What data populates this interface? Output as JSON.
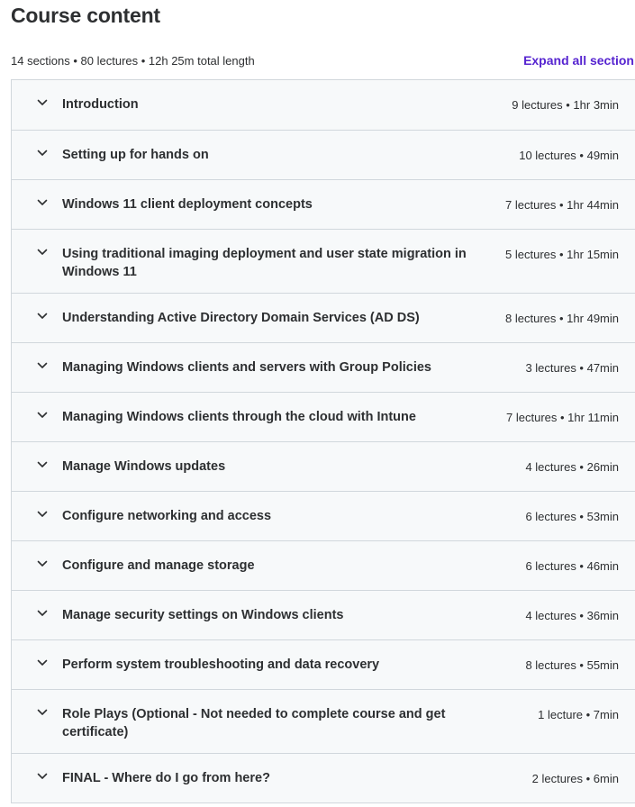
{
  "header": {
    "title": "Course content",
    "summary": "14 sections • 80 lectures • 12h 25m total length",
    "expand_all_label": "Expand all section"
  },
  "sections": [
    {
      "title": "Introduction",
      "meta": "9 lectures • 1hr 3min"
    },
    {
      "title": "Setting up for hands on",
      "meta": "10 lectures • 49min"
    },
    {
      "title": "Windows 11 client deployment concepts",
      "meta": "7 lectures • 1hr 44min"
    },
    {
      "title": "Using traditional imaging deployment and user state migration in Windows 11",
      "meta": "5 lectures • 1hr 15min"
    },
    {
      "title": "Understanding Active Directory Domain Services (AD DS)",
      "meta": "8 lectures • 1hr 49min"
    },
    {
      "title": "Managing Windows clients and servers with Group Policies",
      "meta": "3 lectures • 47min"
    },
    {
      "title": "Managing Windows clients through the cloud with Intune",
      "meta": "7 lectures • 1hr 11min"
    },
    {
      "title": "Manage Windows updates",
      "meta": "4 lectures • 26min"
    },
    {
      "title": "Configure networking and access",
      "meta": "6 lectures • 53min"
    },
    {
      "title": "Configure and manage storage",
      "meta": "6 lectures • 46min"
    },
    {
      "title": "Manage security settings on Windows clients",
      "meta": "4 lectures • 36min"
    },
    {
      "title": "Perform system troubleshooting and data recovery",
      "meta": "8 lectures • 55min"
    },
    {
      "title": "Role Plays (Optional - Not needed to complete course and get certificate)",
      "meta": "1 lecture • 7min"
    },
    {
      "title": "FINAL - Where do I go from here?",
      "meta": "2 lectures • 6min"
    }
  ],
  "icons": {
    "section_toggle": "chevron-down-icon"
  },
  "colors": {
    "accent": "#5624d0",
    "text": "#2d2f31",
    "row_bg": "#f7f9fa",
    "border": "#d1d7dc"
  }
}
